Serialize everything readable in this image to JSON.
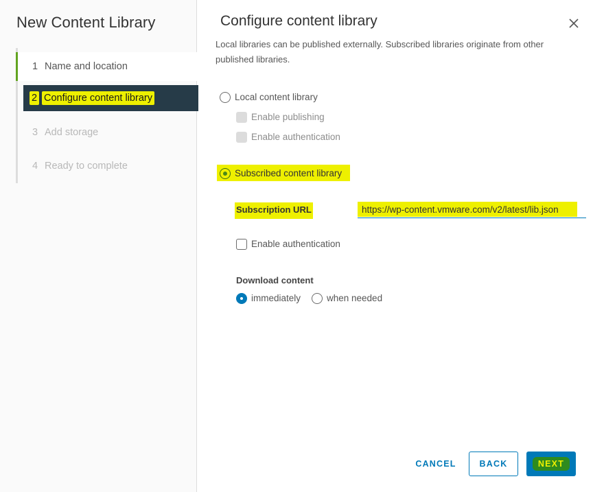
{
  "wizard": {
    "title": "New Content Library",
    "steps": [
      {
        "num": "1",
        "label": "Name and location"
      },
      {
        "num": "2",
        "label": "Configure content library"
      },
      {
        "num": "3",
        "label": "Add storage"
      },
      {
        "num": "4",
        "label": "Ready to complete"
      }
    ]
  },
  "main": {
    "title": "Configure content library",
    "description": "Local libraries can be published externally. Subscribed libraries originate from other published libraries.",
    "local": {
      "label": "Local content library",
      "enable_publishing": "Enable publishing",
      "enable_authentication": "Enable authentication"
    },
    "subscribed": {
      "label": "Subscribed content library",
      "url_label": "Subscription URL",
      "url_value": "https://wp-content.vmware.com/v2/latest/lib.json",
      "enable_authentication": "Enable authentication",
      "download_label": "Download content",
      "download_immediately": "immediately",
      "download_when_needed": "when needed"
    }
  },
  "footer": {
    "cancel": "CANCEL",
    "back": "BACK",
    "next": "NEXT"
  },
  "colors": {
    "accent": "#0079b8",
    "active_step_bg": "#263b48",
    "completed_step": "#62a420",
    "highlight": "#eef000"
  }
}
